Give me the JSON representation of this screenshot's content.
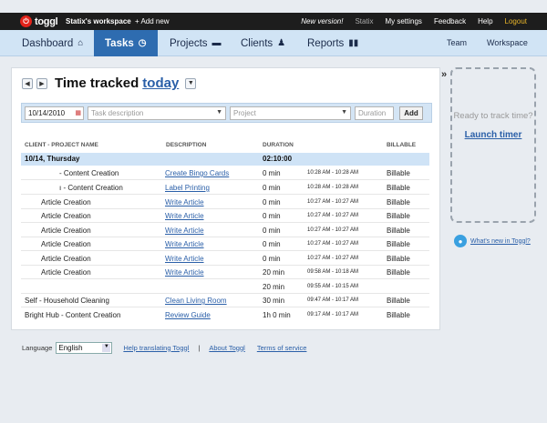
{
  "topbar": {
    "logo_text": "toggl",
    "workspace": "Statix's workspace",
    "add_new": "+ Add new",
    "new_version": "New version!",
    "user": "Statix",
    "settings": "My settings",
    "feedback": "Feedback",
    "help": "Help",
    "logout": "Logout"
  },
  "nav": {
    "tabs": [
      {
        "label": "Dashboard",
        "icon": "home-icon"
      },
      {
        "label": "Tasks",
        "icon": "clock-icon"
      },
      {
        "label": "Projects",
        "icon": "folder-icon"
      },
      {
        "label": "Clients",
        "icon": "people-icon"
      },
      {
        "label": "Reports",
        "icon": "bar-chart-icon"
      }
    ],
    "active": "Tasks",
    "team": "Team",
    "workspace": "Workspace"
  },
  "main": {
    "title": "Time tracked",
    "title_link": "today",
    "entry": {
      "date_value": "10/14/2010",
      "description_placeholder": "Task description",
      "project_placeholder": "Project",
      "duration_placeholder": "Duration",
      "add_label": "Add"
    },
    "columns": {
      "client": "CLIENT - PROJECT NAME",
      "description": "DESCRIPTION",
      "duration": "DURATION",
      "billable": "BILLABLE"
    },
    "group": {
      "date": "10/14, Thursday",
      "total": "02:10:00"
    },
    "rows": [
      {
        "client": "- Content Creation",
        "desc": "Create Bingo Cards",
        "dur": "0 min",
        "time": "10:28 AM - 10:28 AM",
        "bill": "Billable"
      },
      {
        "client": "ı - Content Creation",
        "desc": "Label Printing",
        "dur": "0 min",
        "time": "10:28 AM - 10:28 AM",
        "bill": "Billable"
      },
      {
        "client": "Article Creation",
        "desc": "Write Article",
        "dur": "0 min",
        "time": "10:27 AM - 10:27 AM",
        "bill": "Billable"
      },
      {
        "client": "Article Creation",
        "desc": "Write Article",
        "dur": "0 min",
        "time": "10:27 AM - 10:27 AM",
        "bill": "Billable"
      },
      {
        "client": "Article Creation",
        "desc": "Write Article",
        "dur": "0 min",
        "time": "10:27 AM - 10:27 AM",
        "bill": "Billable"
      },
      {
        "client": "Article Creation",
        "desc": "Write Article",
        "dur": "0 min",
        "time": "10:27 AM - 10:27 AM",
        "bill": "Billable"
      },
      {
        "client": "Article Creation",
        "desc": "Write Article",
        "dur": "0 min",
        "time": "10:27 AM - 10:27 AM",
        "bill": "Billable"
      },
      {
        "client": "Article Creation",
        "desc": "Write Article",
        "dur": "20 min",
        "time": "09:58 AM - 10:18 AM",
        "bill": "Billable"
      },
      {
        "client": "",
        "desc": "",
        "dur": "20 min",
        "time": "09:55 AM - 10:15 AM",
        "bill": ""
      },
      {
        "client": "Self - Household Cleaning",
        "desc": "Clean Living Room",
        "dur": "30 min",
        "time": "09:47 AM - 10:17 AM",
        "bill": "Billable"
      },
      {
        "client": "Bright Hub - Content Creation",
        "desc": "Review Guide",
        "dur": "1h 0 min",
        "time": "09:17 AM - 10:17 AM",
        "bill": "Billable"
      }
    ]
  },
  "footer": {
    "language_label": "Language",
    "language_value": "English",
    "help_translate": "Help translating Toggl",
    "separator": "|",
    "about": "About Toggl",
    "terms": "Terms of service"
  },
  "timer": {
    "ready_text": "Ready to track time?",
    "launch": "Launch timer"
  },
  "news": {
    "link": "What's new in Toggl?"
  }
}
